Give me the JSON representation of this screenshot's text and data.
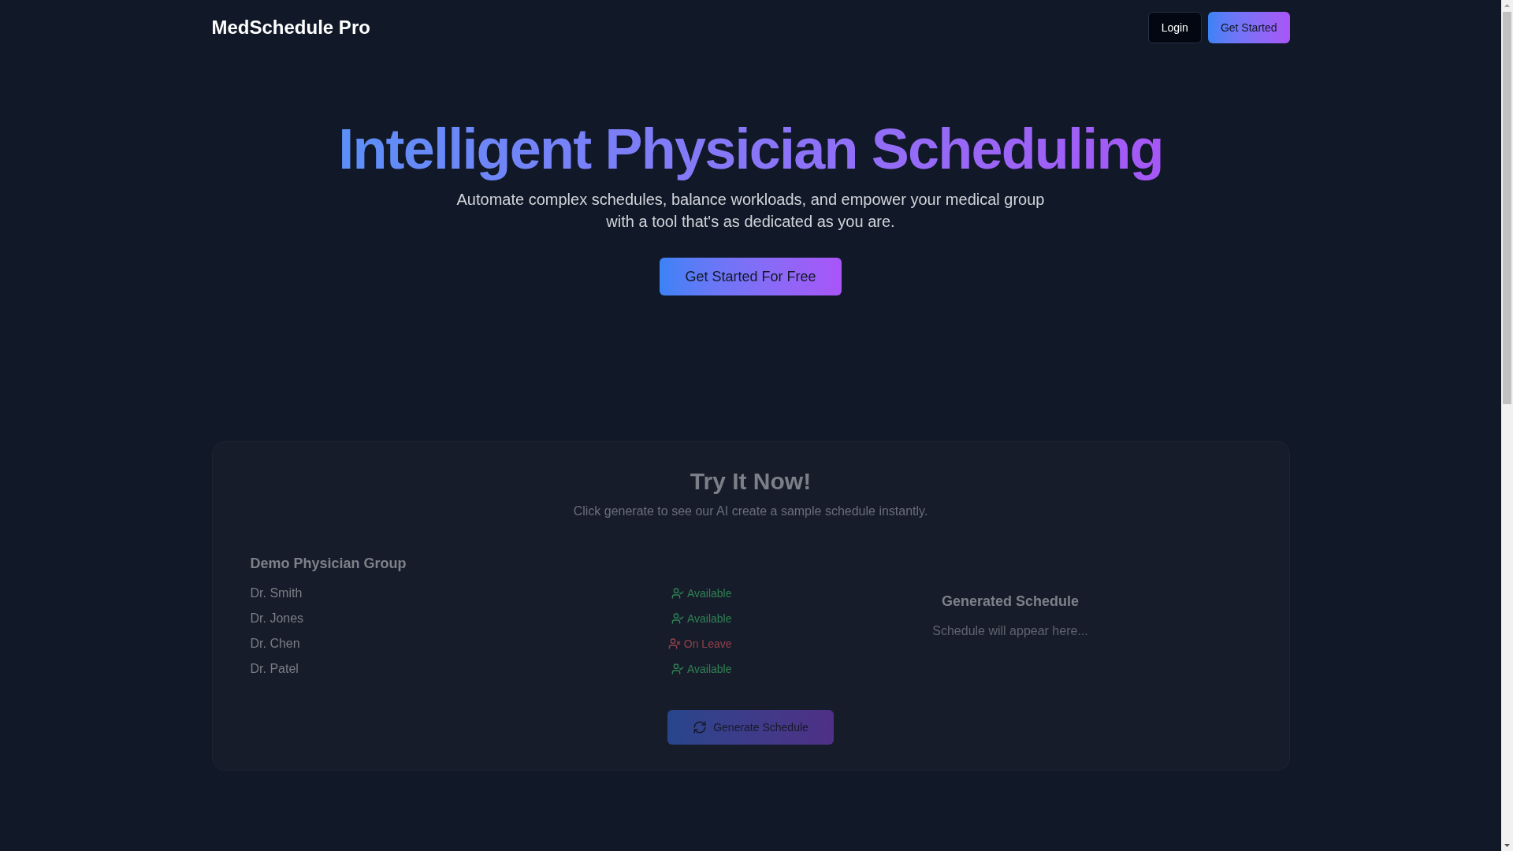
{
  "header": {
    "brand": "MedSchedule Pro",
    "buttons": [
      {
        "label": "Login",
        "kind": "outline"
      },
      {
        "label": "Get Started",
        "kind": "gradient"
      }
    ]
  },
  "hero": {
    "title": "Intelligent Physician Scheduling",
    "subtitle": "Automate complex schedules, balance workloads, and empower your medical group with a tool that's as dedicated as you are.",
    "cta": "Get Started For Free"
  },
  "demo": {
    "title": "Try It Now!",
    "subtitle": "Click generate to see our AI create a sample schedule instantly.",
    "group": {
      "name": "Demo Physician Group",
      "physicians": [
        {
          "name": "Dr. Smith",
          "status": "Available",
          "kind": "available"
        },
        {
          "name": "Dr. Jones",
          "status": "Available",
          "kind": "available"
        },
        {
          "name": "Dr. Chen",
          "status": "On Leave",
          "kind": "on_leave"
        },
        {
          "name": "Dr. Patel",
          "status": "Available",
          "kind": "available"
        }
      ]
    },
    "schedule": {
      "title": "Generated Schedule",
      "empty_message": "Schedule will appear here..."
    },
    "generate_button": "Generate Schedule"
  }
}
